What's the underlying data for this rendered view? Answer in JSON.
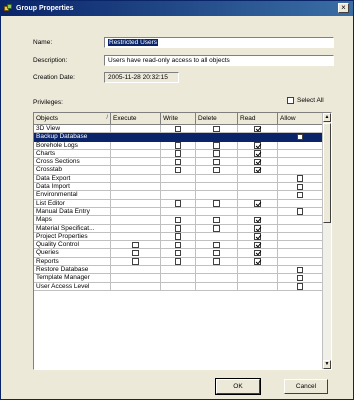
{
  "window": {
    "title": "Group Properties",
    "close_glyph": "×"
  },
  "form": {
    "name_label": "Name:",
    "name_value": "Restricted Users",
    "description_label": "Description:",
    "description_value": "Users have read-only access to all objects",
    "creation_date_label": "Creation Date:",
    "creation_date_value": "2005-11-28 20:32:15"
  },
  "privileges": {
    "label": "Privileges:",
    "select_all_label": "Select All",
    "select_all_checked": false
  },
  "grid": {
    "columns": [
      "Objects",
      "Execute",
      "Write",
      "Delete",
      "Read",
      "Allow"
    ],
    "sort_glyph": "/",
    "rows": [
      {
        "name": "3D View",
        "execute": null,
        "write": false,
        "delete": false,
        "read": true,
        "allow": null,
        "selected": false
      },
      {
        "name": "Backup Database",
        "execute": null,
        "write": null,
        "delete": null,
        "read": null,
        "allow": false,
        "selected": true
      },
      {
        "name": "Borehole Logs",
        "execute": null,
        "write": false,
        "delete": false,
        "read": true,
        "allow": null,
        "selected": false
      },
      {
        "name": "Charts",
        "execute": null,
        "write": false,
        "delete": false,
        "read": true,
        "allow": null,
        "selected": false
      },
      {
        "name": "Cross Sections",
        "execute": null,
        "write": false,
        "delete": false,
        "read": true,
        "allow": null,
        "selected": false
      },
      {
        "name": "Crosstab",
        "execute": null,
        "write": false,
        "delete": false,
        "read": true,
        "allow": null,
        "selected": false
      },
      {
        "name": "Data Export",
        "execute": null,
        "write": null,
        "delete": null,
        "read": null,
        "allow": false,
        "selected": false
      },
      {
        "name": "Data Import",
        "execute": null,
        "write": null,
        "delete": null,
        "read": null,
        "allow": false,
        "selected": false
      },
      {
        "name": "Environmental",
        "execute": null,
        "write": null,
        "delete": null,
        "read": null,
        "allow": false,
        "selected": false
      },
      {
        "name": "List Editor",
        "execute": null,
        "write": false,
        "delete": false,
        "read": true,
        "allow": null,
        "selected": false
      },
      {
        "name": "Manual Data Entry",
        "execute": null,
        "write": null,
        "delete": null,
        "read": null,
        "allow": false,
        "selected": false
      },
      {
        "name": "Maps",
        "execute": null,
        "write": false,
        "delete": false,
        "read": true,
        "allow": null,
        "selected": false
      },
      {
        "name": "Material Specificat...",
        "execute": null,
        "write": false,
        "delete": false,
        "read": true,
        "allow": null,
        "selected": false
      },
      {
        "name": "Project Properties",
        "execute": null,
        "write": false,
        "delete": null,
        "read": true,
        "allow": null,
        "selected": false
      },
      {
        "name": "Quality Control",
        "execute": false,
        "write": false,
        "delete": false,
        "read": true,
        "allow": null,
        "selected": false
      },
      {
        "name": "Queries",
        "execute": false,
        "write": false,
        "delete": false,
        "read": true,
        "allow": null,
        "selected": false
      },
      {
        "name": "Reports",
        "execute": false,
        "write": false,
        "delete": false,
        "read": true,
        "allow": null,
        "selected": false
      },
      {
        "name": "Restore Database",
        "execute": null,
        "write": null,
        "delete": null,
        "read": null,
        "allow": false,
        "selected": false
      },
      {
        "name": "Template Manager",
        "execute": null,
        "write": null,
        "delete": null,
        "read": null,
        "allow": false,
        "selected": false
      },
      {
        "name": "User Access Level",
        "execute": null,
        "write": null,
        "delete": null,
        "read": null,
        "allow": false,
        "selected": false
      }
    ]
  },
  "scroll": {
    "up_glyph": "▲",
    "down_glyph": "▼"
  },
  "buttons": {
    "ok": "OK",
    "cancel": "Cancel"
  },
  "colors": {
    "titlebar": "#0a246a",
    "selection": "#0a246a",
    "dialog": "#ece9d8"
  }
}
